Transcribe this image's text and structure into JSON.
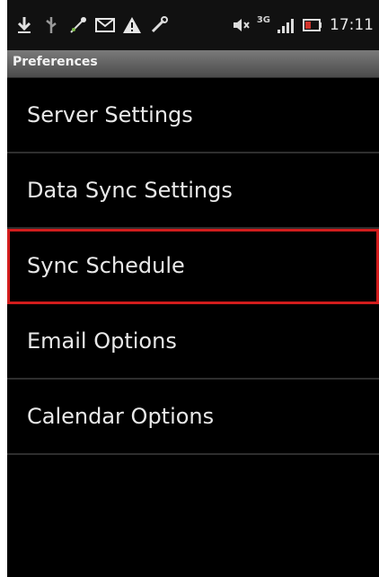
{
  "status_bar": {
    "time": "17:11",
    "network_label": "3G",
    "icons": [
      "download-icon",
      "usb-icon",
      "signal-boost-icon",
      "mail-icon",
      "warning-icon",
      "tools-icon",
      "mute-icon",
      "signal-bars-icon",
      "battery-icon"
    ]
  },
  "title_bar": {
    "title": "Preferences"
  },
  "menu": {
    "items": [
      {
        "label": "Server Settings",
        "selected": false
      },
      {
        "label": "Data Sync Settings",
        "selected": false
      },
      {
        "label": "Sync Schedule",
        "selected": true
      },
      {
        "label": "Email Options",
        "selected": false
      },
      {
        "label": "Calendar Options",
        "selected": false
      }
    ]
  },
  "colors": {
    "background": "#000000",
    "highlight_border": "#d21c1c",
    "text": "#e8e8e8"
  }
}
